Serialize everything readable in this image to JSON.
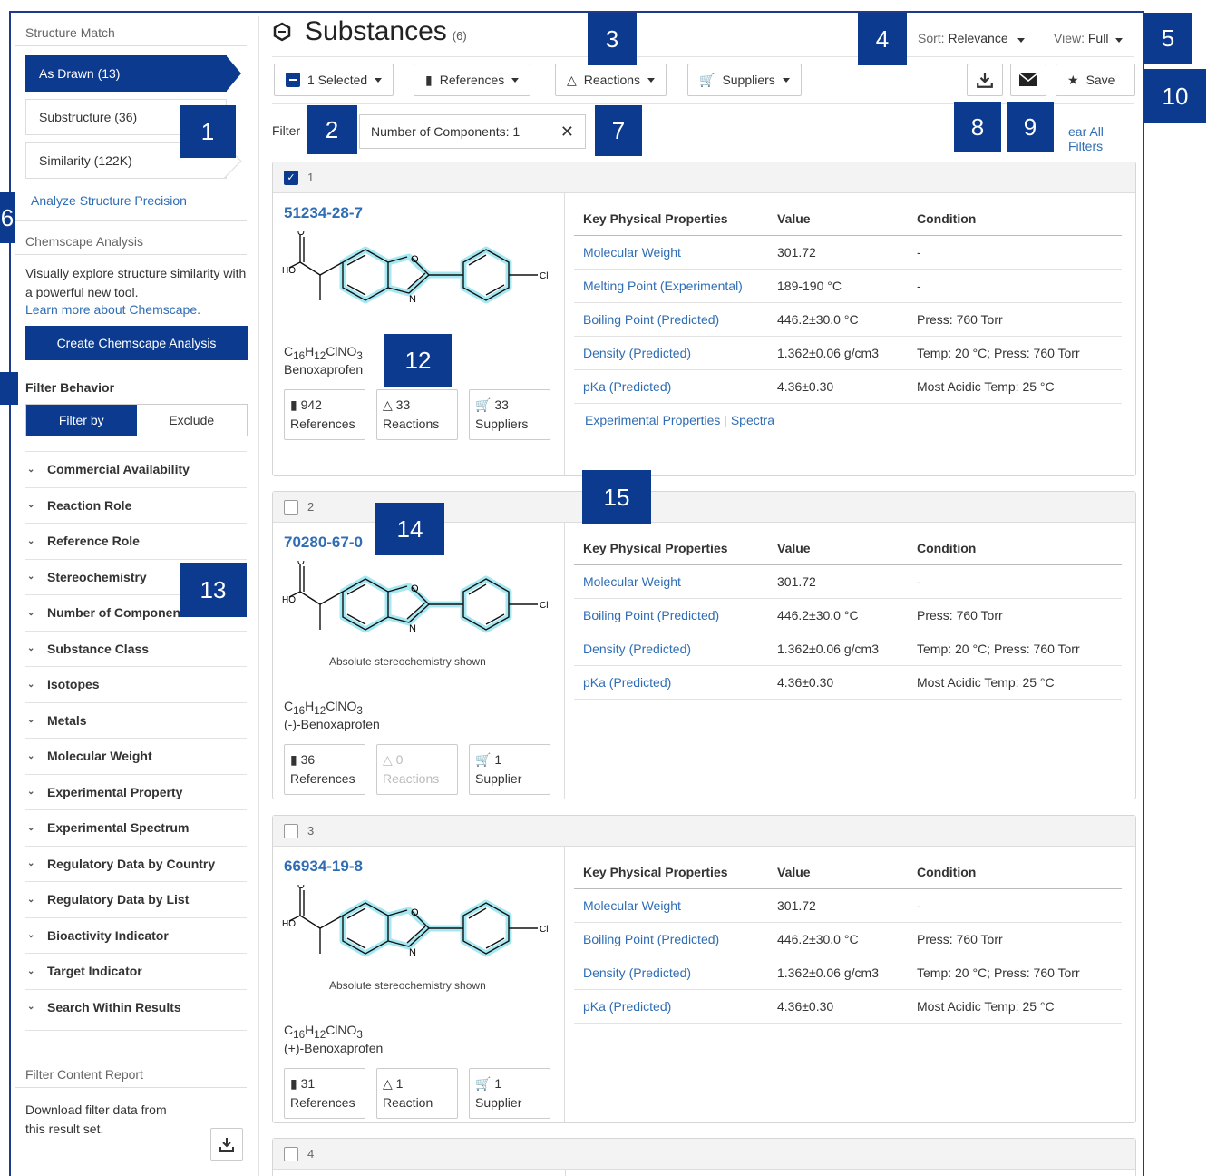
{
  "sidebar": {
    "structure_match_label": "Structure Match",
    "match_items": [
      {
        "label": "As Drawn (13)"
      },
      {
        "label": "Substructure (36)"
      },
      {
        "label": "Similarity (122K)"
      }
    ],
    "precision_link": "Analyze Structure Precision",
    "chemscape_heading": "Chemscape Analysis",
    "chemscape_text": "Visually explore structure similarity with a powerful new tool.",
    "chemscape_link": "Learn more about Chemscape.",
    "chemscape_button": "Create Chemscape Analysis",
    "filter_behavior_label": "Filter Behavior",
    "filter_by": "Filter by",
    "exclude": "Exclude",
    "facets": [
      "Commercial Availability",
      "Reaction Role",
      "Reference Role",
      "Stereochemistry",
      "Number of Components",
      "Substance Class",
      "Isotopes",
      "Metals",
      "Molecular Weight",
      "Experimental Property",
      "Experimental Spectrum",
      "Regulatory Data by Country",
      "Regulatory Data by List",
      "Bioactivity Indicator",
      "Target Indicator",
      "Search Within Results"
    ],
    "report_heading": "Filter Content Report",
    "report_text": "Download filter data from this result set."
  },
  "header": {
    "title": "Substances",
    "count": "(6)",
    "sort_label": "Sort:",
    "sort_value": "Relevance",
    "view_label": "View:",
    "view_value": "Full"
  },
  "toolbar": {
    "selected": "1 Selected",
    "references": "References",
    "reactions": "Reactions",
    "suppliers": "Suppliers",
    "save": "Save"
  },
  "filters": {
    "label": "Filter",
    "chip": "Number of Components: 1",
    "clear_all": "ear All Filters"
  },
  "prop_headers": [
    "Key Physical Properties",
    "Value",
    "Condition"
  ],
  "results": [
    {
      "index": "1",
      "checked": true,
      "cas": "51234-28-7",
      "stereo_note": "",
      "formula": "C16H12ClNO3",
      "name": "Benoxaprofen",
      "references": "942",
      "references_label": "References",
      "reactions": "33",
      "reactions_label": "Reactions",
      "suppliers": "33",
      "suppliers_label": "Suppliers",
      "props": [
        [
          "Molecular Weight",
          "301.72",
          "-"
        ],
        [
          "Melting Point (Experimental)",
          "189-190 °C",
          "-"
        ],
        [
          "Boiling Point (Predicted)",
          "446.2±30.0 °C",
          "Press: 760 Torr"
        ],
        [
          "Density (Predicted)",
          "1.362±0.06 g/cm3",
          "Temp: 20 °C; Press: 760 Torr"
        ],
        [
          "pKa (Predicted)",
          "4.36±0.30",
          "Most Acidic Temp: 25 °C"
        ]
      ],
      "links": [
        "Experimental Properties",
        "Spectra"
      ]
    },
    {
      "index": "2",
      "checked": false,
      "cas": "70280-67-0",
      "stereo_note": "Absolute stereochemistry shown",
      "formula": "C16H12ClNO3",
      "name": "(-)-Benoxaprofen",
      "references": "36",
      "references_label": "References",
      "reactions": "0",
      "reactions_label": "Reactions",
      "suppliers": "1",
      "suppliers_label": "Supplier",
      "props": [
        [
          "Molecular Weight",
          "301.72",
          "-"
        ],
        [
          "Boiling Point (Predicted)",
          "446.2±30.0 °C",
          "Press: 760 Torr"
        ],
        [
          "Density (Predicted)",
          "1.362±0.06 g/cm3",
          "Temp: 20 °C; Press: 760 Torr"
        ],
        [
          "pKa (Predicted)",
          "4.36±0.30",
          "Most Acidic Temp: 25 °C"
        ]
      ]
    },
    {
      "index": "3",
      "checked": false,
      "cas": "66934-19-8",
      "stereo_note": "Absolute stereochemistry shown",
      "formula": "C16H12ClNO3",
      "name": "(+)-Benoxaprofen",
      "references": "31",
      "references_label": "References",
      "reactions": "1",
      "reactions_label": "Reaction",
      "suppliers": "1",
      "suppliers_label": "Supplier",
      "props": [
        [
          "Molecular Weight",
          "301.72",
          "-"
        ],
        [
          "Boiling Point (Predicted)",
          "446.2±30.0 °C",
          "Press: 760 Torr"
        ],
        [
          "Density (Predicted)",
          "1.362±0.06 g/cm3",
          "Temp: 20 °C; Press: 760 Torr"
        ],
        [
          "pKa (Predicted)",
          "4.36±0.30",
          "Most Acidic Temp: 25 °C"
        ]
      ]
    },
    {
      "index": "4",
      "checked": false
    }
  ],
  "markers": [
    "1",
    "2",
    "3",
    "4",
    "5",
    "6",
    "7",
    "8",
    "9",
    "10",
    "12",
    "13",
    "14",
    "15"
  ],
  "colors": {
    "accent": "#0b3a8e",
    "link": "#2f6db5",
    "highlight": "#8fe3ef"
  }
}
